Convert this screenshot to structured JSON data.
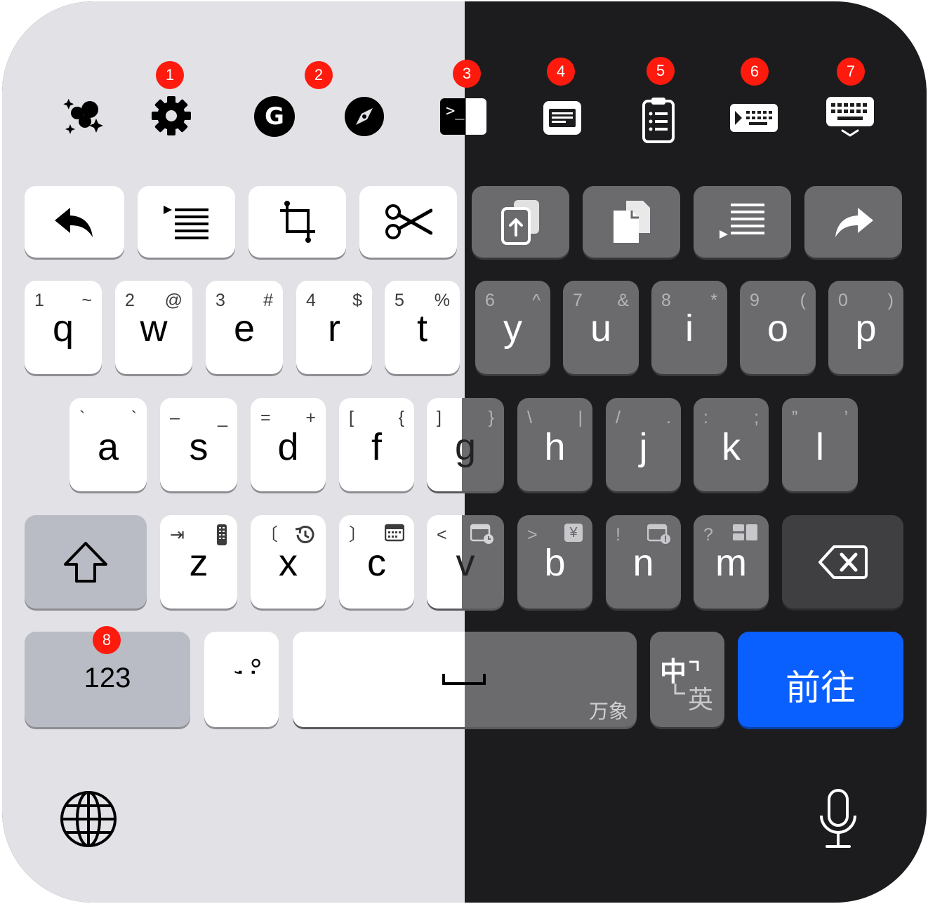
{
  "toolbar": {
    "items": [
      {
        "icon": "sparkles-icon"
      },
      {
        "icon": "gear-icon",
        "badge": "1"
      },
      {
        "icon": "grammarly-icon",
        "letter": "G",
        "badge": "2"
      },
      {
        "icon": "compass-icon"
      },
      {
        "icon": "terminal-icon",
        "text": ">_",
        "badge": "3"
      },
      {
        "icon": "text-panel-icon",
        "badge": "4"
      },
      {
        "icon": "clipboard-icon",
        "badge": "5"
      },
      {
        "icon": "keyboard-play-icon",
        "badge": "6"
      },
      {
        "icon": "keyboard-dismiss-icon",
        "badge": "7"
      }
    ]
  },
  "edit_row": [
    {
      "icon": "undo-icon"
    },
    {
      "icon": "indent-icon"
    },
    {
      "icon": "crop-icon"
    },
    {
      "icon": "scissors-icon"
    },
    {
      "icon": "paste-icon"
    },
    {
      "icon": "copy-icon"
    },
    {
      "icon": "outdent-icon"
    },
    {
      "icon": "redo-icon"
    }
  ],
  "row1": [
    {
      "letter": "q",
      "sub1": "1",
      "sub2": "~"
    },
    {
      "letter": "w",
      "sub1": "2",
      "sub2": "@"
    },
    {
      "letter": "e",
      "sub1": "3",
      "sub2": "#"
    },
    {
      "letter": "r",
      "sub1": "4",
      "sub2": "$"
    },
    {
      "letter": "t",
      "sub1": "5",
      "sub2": "%"
    },
    {
      "letter": "y",
      "sub1": "6",
      "sub2": "^"
    },
    {
      "letter": "u",
      "sub1": "7",
      "sub2": "&"
    },
    {
      "letter": "i",
      "sub1": "8",
      "sub2": "*"
    },
    {
      "letter": "o",
      "sub1": "9",
      "sub2": "("
    },
    {
      "letter": "p",
      "sub1": "0",
      "sub2": ")"
    }
  ],
  "row2": [
    {
      "letter": "a",
      "sub1": "`",
      "sub2": "`"
    },
    {
      "letter": "s",
      "sub1": "–",
      "sub2": "_"
    },
    {
      "letter": "d",
      "sub1": "=",
      "sub2": "+"
    },
    {
      "letter": "f",
      "sub1": "[",
      "sub2": "{"
    },
    {
      "letter": "g",
      "sub1": "]",
      "sub2": "}"
    },
    {
      "letter": "h",
      "sub1": "\\",
      "sub2": "|"
    },
    {
      "letter": "j",
      "sub1": "/",
      "sub2": "."
    },
    {
      "letter": "k",
      "sub1": ":",
      "sub2": ";"
    },
    {
      "letter": "l",
      "sub1": "”",
      "sub2": "’"
    }
  ],
  "row3": [
    {
      "letter": "z",
      "sub1": "⇥",
      "icon": "remote-icon"
    },
    {
      "letter": "x",
      "sub1": "〔",
      "icon": "history-icon"
    },
    {
      "letter": "c",
      "sub1": "〕",
      "icon": "calendar-icon"
    },
    {
      "letter": "v",
      "sub1": "<",
      "icon": "calendar-clock-icon"
    },
    {
      "letter": "b",
      "sub1": ">",
      "icon": "yen-icon",
      "icon_text": "¥"
    },
    {
      "letter": "n",
      "sub1": "!",
      "icon": "calendar-alert-icon"
    },
    {
      "letter": "m",
      "sub1": "?",
      "icon": "layout-icon"
    }
  ],
  "bottom": {
    "numbers_label": "123",
    "numbers_badge": "8",
    "punct_label": "°;",
    "space_hint": "万象",
    "lang_top": "中",
    "lang_bottom": "英",
    "go_label": "前往"
  },
  "colors": {
    "light_bg": "#e1e1e6",
    "dark_bg": "#1c1c1e",
    "badge": "#ff1a0e",
    "go_button": "#0a60ff"
  }
}
